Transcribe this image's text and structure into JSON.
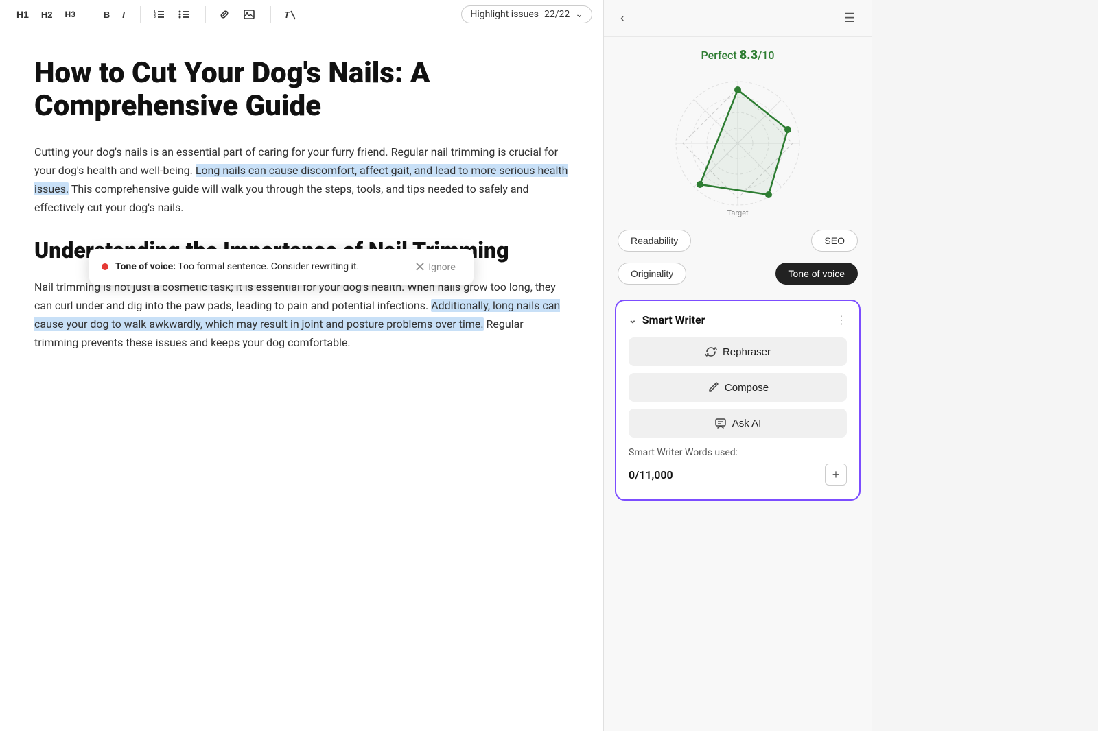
{
  "toolbar": {
    "h1_label": "H1",
    "h2_label": "H2",
    "h3_label": "H3",
    "bold_label": "B",
    "italic_label": "I",
    "highlight_label": "Highlight issues",
    "highlight_count": "22/22"
  },
  "editor": {
    "title": "How to Cut Your Dog's Nails: A Comprehensive Guide",
    "intro": "Cutting your dog's nails is an essential part of caring for your furry friend. Regular nail trimming is crucial for your dog's health and well-being.",
    "highlighted_text": "Long nails can cause discomfort, affect gait, and lead to more serious health issues.",
    "intro_end": " This comprehensive guide will walk you through the steps, tools, and tips needed to safely and effectively cut your dog's nails.",
    "h2": "Understanding the Importance of Nail Trimming",
    "body": "Nail trimming is not just a cosmetic task; it is essential for your dog's health. When nails grow too long, they can curl under and dig into the paw pads, leading to pain and potential infections.",
    "highlighted_text2": "Additionally, long nails can cause your dog to walk awkwardly, which may result in joint and posture problems over time.",
    "body_end": " Regular trimming prevents these issues and keeps your dog comfortable."
  },
  "tooltip": {
    "label": "Tone of voice:",
    "message": "Too formal sentence. Consider rewriting it.",
    "ignore_label": "Ignore"
  },
  "right_panel": {
    "score_prefix": "Perfect ",
    "score_value": "8.3",
    "score_suffix": "/10",
    "radar_label": "Target",
    "pills": [
      {
        "label": "Readability",
        "active": false
      },
      {
        "label": "SEO",
        "active": false
      },
      {
        "label": "Originality",
        "active": false
      },
      {
        "label": "Tone of voice",
        "active": true
      }
    ],
    "smart_writer": {
      "title": "Smart Writer",
      "rephraser_label": "Rephraser",
      "compose_label": "Compose",
      "ask_ai_label": "Ask AI",
      "words_used_label": "Smart Writer Words used:",
      "words_count": "0/11,000"
    }
  }
}
